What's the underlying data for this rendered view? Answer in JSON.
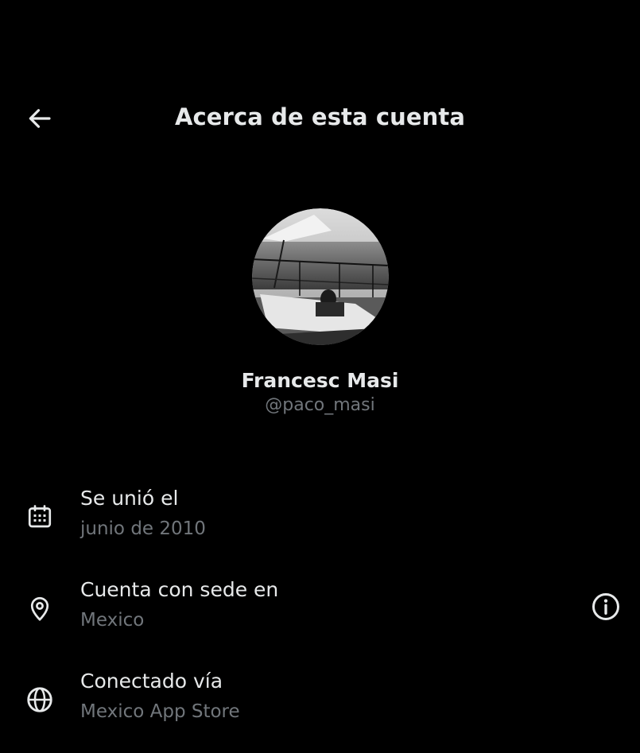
{
  "header": {
    "title": "Acerca de esta cuenta",
    "back_icon": "arrow-left-icon"
  },
  "profile": {
    "name": "Francesc Masi",
    "handle": "@paco_masi",
    "avatar": "avatar-photo"
  },
  "details": [
    {
      "icon": "calendar-icon",
      "label": "Se unió el",
      "value": "junio de 2010"
    },
    {
      "icon": "location-pin-icon",
      "label": "Cuenta con sede en",
      "value": "Mexico",
      "action_icon": "info-icon"
    },
    {
      "icon": "globe-icon",
      "label": "Conectado vía",
      "value": "Mexico App Store"
    }
  ],
  "colors": {
    "background": "#000000",
    "primary_text": "#e7e9ea",
    "secondary_text": "#71767b"
  }
}
